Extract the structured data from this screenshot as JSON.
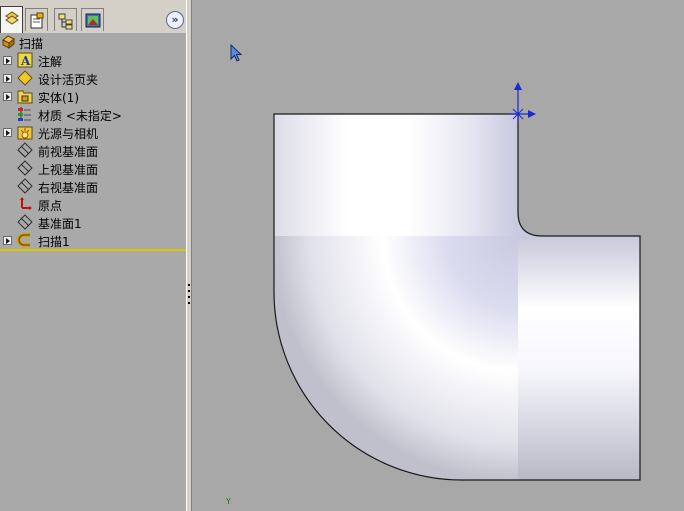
{
  "panel": {
    "tabs": [
      {
        "icon": "feature-manager-icon",
        "active": true
      },
      {
        "icon": "property-manager-icon",
        "active": false
      },
      {
        "icon": "configuration-manager-icon",
        "active": false
      },
      {
        "icon": "display-manager-icon",
        "active": false
      }
    ],
    "expand_label": "»"
  },
  "tree": {
    "root": "扫描",
    "items": [
      {
        "label": "注解",
        "icon": "annotation-icon",
        "expandable": true
      },
      {
        "label": "设计活页夹",
        "icon": "design-binder-icon",
        "expandable": true
      },
      {
        "label": "实体(1)",
        "icon": "solid-bodies-icon",
        "expandable": true
      },
      {
        "label": "材质 <未指定>",
        "icon": "material-icon",
        "expandable": false
      },
      {
        "label": "光源与相机",
        "icon": "lights-camera-icon",
        "expandable": true
      },
      {
        "label": "前视基准面",
        "icon": "plane-icon",
        "expandable": false
      },
      {
        "label": "上视基准面",
        "icon": "plane-icon",
        "expandable": false
      },
      {
        "label": "右视基准面",
        "icon": "plane-icon",
        "expandable": false
      },
      {
        "label": "原点",
        "icon": "origin-icon",
        "expandable": false
      },
      {
        "label": "基准面1",
        "icon": "plane-icon",
        "expandable": false
      },
      {
        "label": "扫描1",
        "icon": "sweep-feature-icon",
        "expandable": true
      }
    ]
  },
  "viewport": {
    "axis_label": "Y",
    "colors": {
      "background": "#a8a8a8",
      "edge": "#1a1a1a",
      "highlight": "#ffffff",
      "shade": "#c8c8d6",
      "triad_blue": "#1a2ad0"
    }
  }
}
